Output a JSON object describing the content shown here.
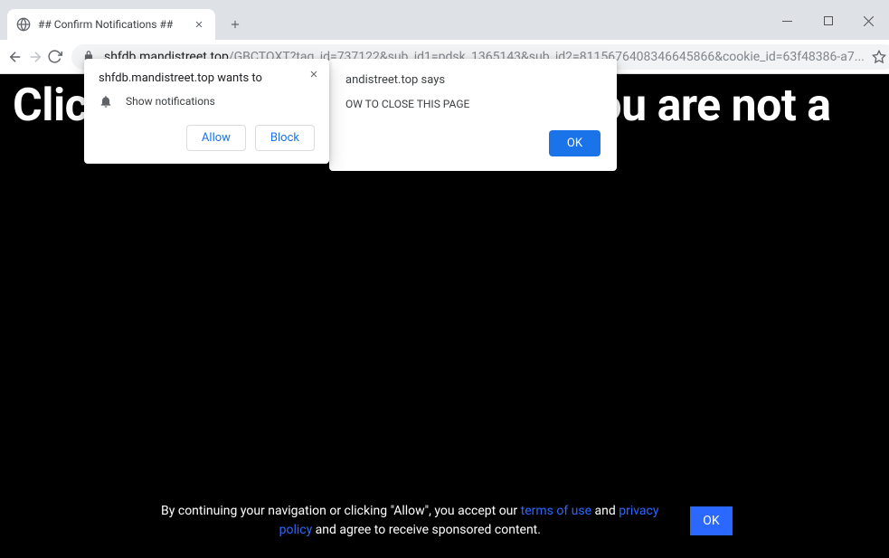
{
  "tab": {
    "title": "## Confirm Notifications ##"
  },
  "url": {
    "host": "shfdb.mandistreet.top",
    "path": "/GBCTQXT?tag_id=737122&sub_id1=pdsk_1365143&sub_id2=8115676408346645866&cookie_id=63f48386-a7..."
  },
  "page": {
    "hero": "Click \"Allow\" to confirm that you are not a"
  },
  "permission": {
    "title": "shfdb.mandistreet.top wants to",
    "item": "Show notifications",
    "allow": "Allow",
    "block": "Block"
  },
  "alert": {
    "title": "andistreet.top says",
    "message": "OW TO CLOSE THIS PAGE",
    "ok": "OK"
  },
  "cookie": {
    "prefix": "By continuing your navigation or clicking \"Allow\", you accept our ",
    "terms": "terms of use",
    "and": " and ",
    "privacy": "privacy policy",
    "suffix": " and agree to receive sponsored content.",
    "ok": "OK"
  }
}
